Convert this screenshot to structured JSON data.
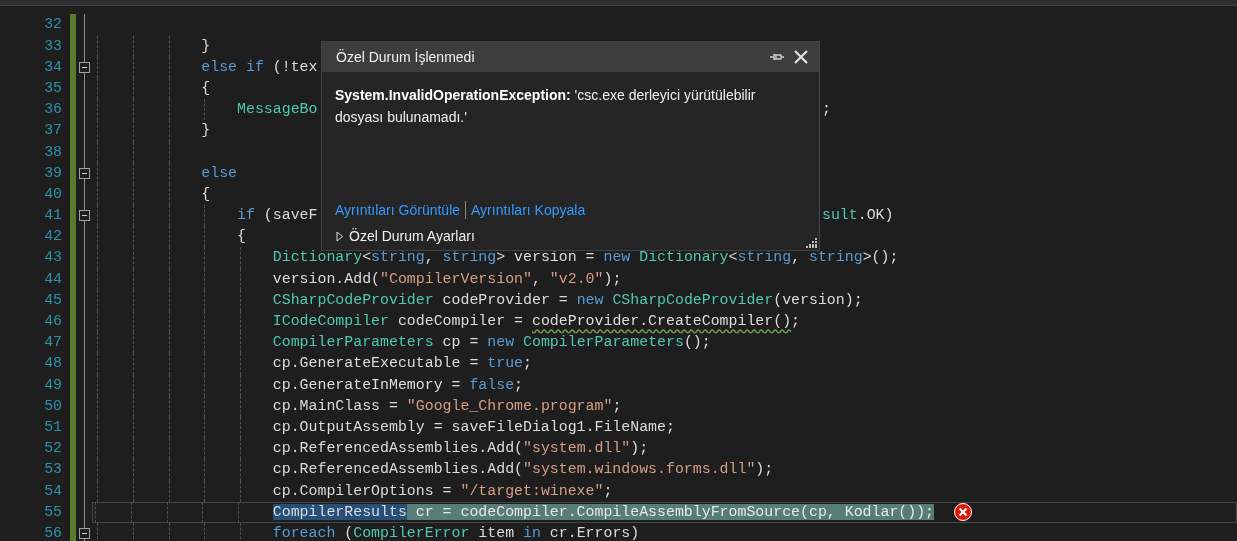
{
  "editor": {
    "lines": [
      {
        "number": "32",
        "changed": true,
        "foldable": false,
        "current": false,
        "error": false
      },
      {
        "number": "33",
        "changed": true,
        "foldable": false,
        "current": false,
        "error": false,
        "code": [
          {
            "kind": "plain",
            "text": "            }"
          }
        ]
      },
      {
        "number": "34",
        "changed": true,
        "foldable": true,
        "current": false,
        "error": false,
        "code": [
          {
            "kind": "kw",
            "text": "            else if"
          },
          {
            "kind": "plain",
            "text": " (!tex"
          }
        ]
      },
      {
        "number": "35",
        "changed": true,
        "foldable": false,
        "current": false,
        "error": false,
        "code": [
          {
            "kind": "plain",
            "text": "            {"
          }
        ]
      },
      {
        "number": "36",
        "changed": true,
        "foldable": false,
        "current": false,
        "error": false,
        "code": [
          {
            "kind": "type",
            "text": "                MessageBo"
          }
        ],
        "tail": [
          {
            "kind": "plain",
            "text": ";"
          }
        ]
      },
      {
        "number": "37",
        "changed": true,
        "foldable": false,
        "current": false,
        "error": false,
        "code": [
          {
            "kind": "plain",
            "text": "            }"
          }
        ]
      },
      {
        "number": "38",
        "changed": true,
        "foldable": false,
        "current": false,
        "error": false
      },
      {
        "number": "39",
        "changed": true,
        "foldable": true,
        "current": false,
        "error": false,
        "code": [
          {
            "kind": "kw",
            "text": "            else"
          }
        ]
      },
      {
        "number": "40",
        "changed": true,
        "foldable": false,
        "current": false,
        "error": false,
        "code": [
          {
            "kind": "plain",
            "text": "            {"
          }
        ]
      },
      {
        "number": "41",
        "changed": true,
        "foldable": true,
        "current": false,
        "error": false,
        "code": [
          {
            "kind": "kw",
            "text": "                if"
          },
          {
            "kind": "plain",
            "text": " (saveF"
          }
        ],
        "tail": [
          {
            "kind": "type",
            "text": "sult"
          },
          {
            "kind": "plain",
            "text": ".OK)"
          }
        ]
      },
      {
        "number": "42",
        "changed": true,
        "foldable": false,
        "current": false,
        "error": false,
        "code": [
          {
            "kind": "plain",
            "text": "                {"
          }
        ]
      },
      {
        "number": "43",
        "changed": true,
        "foldable": false,
        "current": false,
        "error": false,
        "code": [
          {
            "kind": "type",
            "text": "                    Dictionary"
          },
          {
            "kind": "plain",
            "text": "<"
          },
          {
            "kind": "kw",
            "text": "string"
          },
          {
            "kind": "plain",
            "text": ", "
          },
          {
            "kind": "kw",
            "text": "string"
          },
          {
            "kind": "plain",
            "text": "> version = "
          },
          {
            "kind": "kw",
            "text": "new"
          },
          {
            "kind": "type",
            "text": " Dictionary"
          },
          {
            "kind": "plain",
            "text": "<"
          },
          {
            "kind": "kw",
            "text": "string"
          },
          {
            "kind": "plain",
            "text": ", "
          },
          {
            "kind": "kw",
            "text": "string"
          },
          {
            "kind": "plain",
            "text": ">();"
          }
        ]
      },
      {
        "number": "44",
        "changed": true,
        "foldable": false,
        "current": false,
        "error": false,
        "code": [
          {
            "kind": "plain",
            "text": "                    version.Add("
          },
          {
            "kind": "str",
            "text": "\"CompilerVersion\""
          },
          {
            "kind": "plain",
            "text": ", "
          },
          {
            "kind": "str",
            "text": "\"v2.0\""
          },
          {
            "kind": "plain",
            "text": ");"
          }
        ]
      },
      {
        "number": "45",
        "changed": true,
        "foldable": false,
        "current": false,
        "error": false,
        "code": [
          {
            "kind": "type",
            "text": "                    CSharpCodeProvider"
          },
          {
            "kind": "plain",
            "text": " codeProvider = "
          },
          {
            "kind": "kw",
            "text": "new"
          },
          {
            "kind": "type",
            "text": " CSharpCodeProvider"
          },
          {
            "kind": "plain",
            "text": "(version);"
          }
        ]
      },
      {
        "number": "46",
        "changed": true,
        "foldable": false,
        "current": false,
        "error": false,
        "code": [
          {
            "kind": "type",
            "text": "                    ICodeCompiler"
          },
          {
            "kind": "plain",
            "text": " codeCompiler = "
          },
          {
            "kind": "warn",
            "text": "codeProvider.CreateCompiler()"
          },
          {
            "kind": "plain",
            "text": ";"
          }
        ]
      },
      {
        "number": "47",
        "changed": true,
        "foldable": false,
        "current": false,
        "error": false,
        "code": [
          {
            "kind": "type",
            "text": "                    CompilerParameters"
          },
          {
            "kind": "plain",
            "text": " cp = "
          },
          {
            "kind": "kw",
            "text": "new"
          },
          {
            "kind": "type",
            "text": " CompilerParameters"
          },
          {
            "kind": "plain",
            "text": "();"
          }
        ]
      },
      {
        "number": "48",
        "changed": true,
        "foldable": false,
        "current": false,
        "error": false,
        "code": [
          {
            "kind": "plain",
            "text": "                    cp.GenerateExecutable = "
          },
          {
            "kind": "kw",
            "text": "true"
          },
          {
            "kind": "plain",
            "text": ";"
          }
        ]
      },
      {
        "number": "49",
        "changed": true,
        "foldable": false,
        "current": false,
        "error": false,
        "code": [
          {
            "kind": "plain",
            "text": "                    cp.GenerateInMemory = "
          },
          {
            "kind": "kw",
            "text": "false"
          },
          {
            "kind": "plain",
            "text": ";"
          }
        ]
      },
      {
        "number": "50",
        "changed": true,
        "foldable": false,
        "current": false,
        "error": false,
        "code": [
          {
            "kind": "plain",
            "text": "                    cp.MainClass = "
          },
          {
            "kind": "str",
            "text": "\"Google_Chrome.program\""
          },
          {
            "kind": "plain",
            "text": ";"
          }
        ]
      },
      {
        "number": "51",
        "changed": true,
        "foldable": false,
        "current": false,
        "error": false,
        "code": [
          {
            "kind": "plain",
            "text": "                    cp.OutputAssembly = saveFileDialog1.FileName;"
          }
        ]
      },
      {
        "number": "52",
        "changed": true,
        "foldable": false,
        "current": false,
        "error": false,
        "code": [
          {
            "kind": "plain",
            "text": "                    cp.ReferencedAssemblies.Add("
          },
          {
            "kind": "str",
            "text": "\"system.dll\""
          },
          {
            "kind": "plain",
            "text": ");"
          }
        ]
      },
      {
        "number": "53",
        "changed": true,
        "foldable": false,
        "current": false,
        "error": false,
        "code": [
          {
            "kind": "plain",
            "text": "                    cp.ReferencedAssemblies.Add("
          },
          {
            "kind": "str",
            "text": "\"system.windows.forms.dll\""
          },
          {
            "kind": "plain",
            "text": ");"
          }
        ]
      },
      {
        "number": "54",
        "changed": true,
        "foldable": false,
        "current": false,
        "error": false,
        "code": [
          {
            "kind": "plain",
            "text": "                    cp.CompilerOptions = "
          },
          {
            "kind": "str",
            "text": "\"/target:winexe\""
          },
          {
            "kind": "plain",
            "text": ";"
          }
        ]
      },
      {
        "number": "55",
        "changed": true,
        "foldable": false,
        "current": true,
        "error": true,
        "code": [
          {
            "kind": "sel",
            "text": "                    CompilerResults"
          },
          {
            "kind": "hl",
            "text": " cr = codeCompiler.CompileAssemblyFromSource(cp, Kodlar());"
          }
        ]
      },
      {
        "number": "56",
        "changed": true,
        "foldable": true,
        "current": false,
        "error": false,
        "code": [
          {
            "kind": "kw",
            "text": "                    foreach"
          },
          {
            "kind": "plain",
            "text": " ("
          },
          {
            "kind": "type",
            "text": "CompilerError"
          },
          {
            "kind": "plain",
            "text": " item "
          },
          {
            "kind": "kw",
            "text": "in"
          },
          {
            "kind": "plain",
            "text": " cr.Errors)"
          }
        ]
      }
    ]
  },
  "exception_popup": {
    "title": "Özel Durum İşlenmedi",
    "message": "**System.InvalidOperationException:** 'csc.exe derleyici yürütülebilir dosyası bulunamadı.'",
    "links": [
      "Ayrıntıları Görüntüle",
      "Ayrıntıları Kopyala"
    ],
    "settings": {
      "label": "Özel Durum Ayarları",
      "expanded": false
    }
  }
}
